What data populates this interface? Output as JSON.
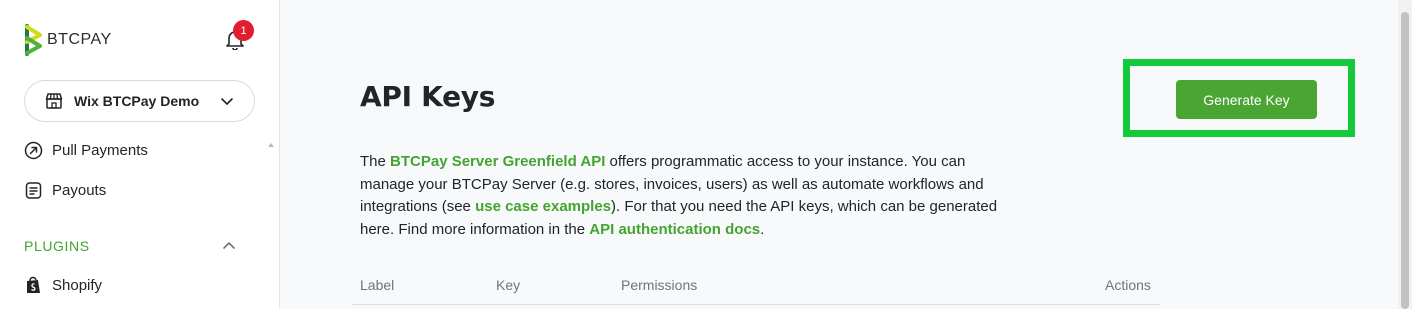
{
  "brand": {
    "name": "BTCPAY",
    "accent": "#44a431",
    "logo_color": "#51b13e"
  },
  "notifications": {
    "count": "1",
    "icon": "bell-icon"
  },
  "store_selector": {
    "name": "Wix BTCPay Demo",
    "icon": "store-icon"
  },
  "sidebar": {
    "items": [
      {
        "label": "Pull Payments",
        "icon": "arrow-circle-icon"
      },
      {
        "label": "Payouts",
        "icon": "document-icon"
      }
    ],
    "plugins_section": {
      "label": "PLUGINS",
      "items": [
        {
          "label": "Shopify",
          "icon": "shopify-bag-icon"
        }
      ]
    }
  },
  "page": {
    "title": "API Keys",
    "generate_button": "Generate Key",
    "description": {
      "t1": "The ",
      "link1": "BTCPay Server Greenfield API",
      "t2": " offers programmatic access to your instance. You can manage your BTCPay Server (e.g. stores, invoices, users) as well as automate workflows and integrations (see ",
      "link2": "use case examples",
      "t3": "). For that you need the API keys, which can be generated here. Find more information in the ",
      "link3": "API authentication docs",
      "t4": "."
    },
    "table": {
      "columns": [
        "Label",
        "Key",
        "Permissions",
        "Actions"
      ]
    }
  },
  "highlight_color": "#14c93a"
}
